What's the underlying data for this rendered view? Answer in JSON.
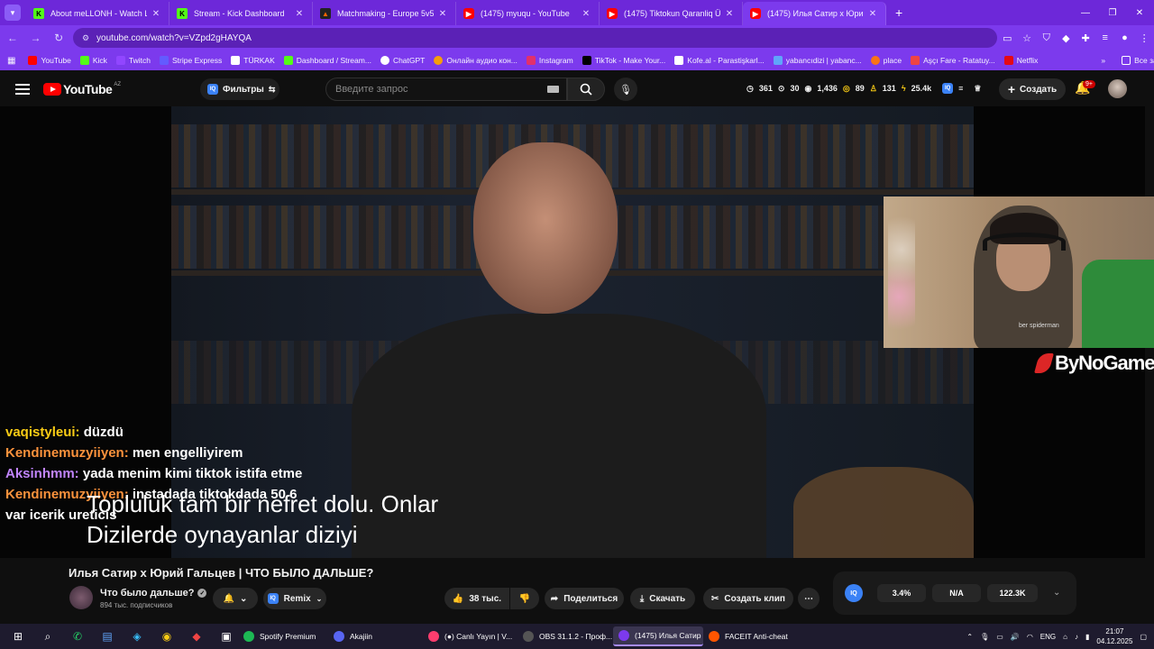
{
  "browser": {
    "tabs": [
      {
        "title": "About meLLONH - Watch Live on",
        "icon": "kick"
      },
      {
        "title": "Stream - Kick Dashboard",
        "icon": "kick"
      },
      {
        "title": "Matchmaking - Europe 5v5 Qu",
        "icon": "mm"
      },
      {
        "title": "(1475) myuqu - YouTube",
        "icon": "yt"
      },
      {
        "title": "(1475) Tiktokun Qaranliq Üzü -",
        "icon": "yt"
      },
      {
        "title": "(1475) Илья Сатир х Юрий Гал",
        "icon": "yt"
      }
    ],
    "url": "youtube.com/watch?v=VZpd2gHAYQA",
    "bookmarks": [
      "YouTube",
      "Kick",
      "Twitch",
      "Stripe Express",
      "TÜRKAK",
      "Dashboard / Stream...",
      "ChatGPT",
      "Онлайн аудио кон...",
      "Instagram",
      "TikTok - Make Your...",
      "Kofe.al - Parastişkarl...",
      "yabancıdizi | yabanc...",
      "place",
      "Aşçı Fare - Ratatuy...",
      "Netflix"
    ],
    "all_bookmarks": "Все закладки"
  },
  "youtube": {
    "logo_text": "YouTube",
    "country": "AZ",
    "filters_label": "Фильтры",
    "search_placeholder": "Введите запрос",
    "stats": {
      "views": "361",
      "a": "30",
      "b": "1,436",
      "c": "89",
      "d": "131",
      "e": "25.4k"
    },
    "create_label": "Создать",
    "notifications": "9+"
  },
  "video": {
    "brand": "ByNoGame",
    "webcam_shirt_text": "ber spiderman",
    "chat": [
      {
        "user": "vaqistyleui:",
        "msg": "düzdü",
        "cls": "u1"
      },
      {
        "user": "Kendinemuzyiiyen:",
        "msg": "men engelliyirem",
        "cls": "u2"
      },
      {
        "user": "Aksinhmm:",
        "msg": "yada menim kimi tiktok istifa etme",
        "cls": "u3"
      },
      {
        "user": "Kendinemuzyiiyen:",
        "msg": "instadada tiktokdada 50 6",
        "cls": "u2"
      },
      {
        "user": "",
        "msg": "var icerik ureticis",
        "cls": ""
      }
    ],
    "subtitle_1": "Topluluk tam bir nefret dolu. Onlar",
    "subtitle_2": "Dizilerde oynayanlar diziyi"
  },
  "meta": {
    "title": "Илья Сатир х Юрий Гальцев | ЧТО БЫЛО ДАЛЬШЕ?",
    "channel": "Что было дальше?",
    "subscribers": "894 тыс. подписчиков",
    "remix": "Remix",
    "likes": "38 тыс.",
    "share": "Поделиться",
    "download": "Скачать",
    "clip": "Создать клип",
    "iq_stats": [
      "3.4%",
      "N/A",
      "122.3K"
    ]
  },
  "taskbar": {
    "apps": [
      {
        "label": "Spotify Premium",
        "color": "#1db954"
      },
      {
        "label": "Akajiin",
        "color": "#5865f2"
      },
      {
        "label": "(●) Canlı Yayın | V...",
        "color": "#ff3d6e"
      },
      {
        "label": "OBS 31.1.2 - Проф...",
        "color": "#302e31"
      },
      {
        "label": "(1475) Илья Сатир ...",
        "color": "#7c3aed"
      },
      {
        "label": "FACEIT Anti-cheat",
        "color": "#ff5500"
      }
    ],
    "lang": "ENG",
    "time": "21:07",
    "date": "04.12.2025"
  }
}
